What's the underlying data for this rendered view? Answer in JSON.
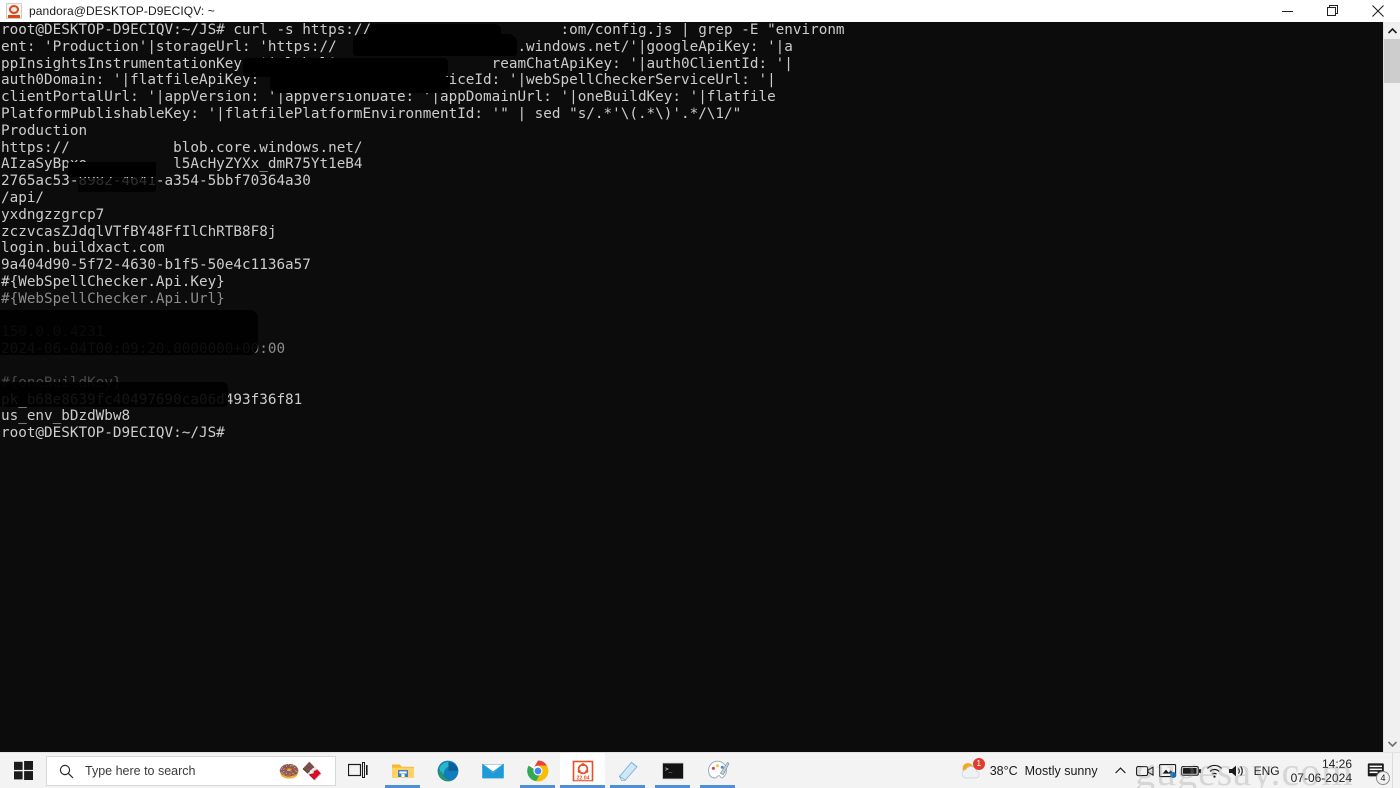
{
  "window": {
    "title": "pandora@DESKTOP-D9ECIQV: ~",
    "icon": "ubuntu-icon",
    "minimize_label": "Minimize",
    "maximize_label": "Restore",
    "close_label": "Close"
  },
  "terminal": {
    "lines": [
      {
        "text": "root@DESKTOP-D9ECIQV:~/JS# curl -s https://app.                  :om/config.js | grep -E \"environm",
        "tone": "normal"
      },
      {
        "text": "ent: 'Production'|storageUrl: 'https://                  ore.windows.net/'|googleApiKey: '|a",
        "tone": "normal"
      },
      {
        "text": "ppInsightsInstrumentationKey: '|globalA                  reamChatApiKey: '|auth0ClientId: '|",
        "tone": "normal"
      },
      {
        "text": "auth0Domain: '|flatfileApiKey: '|webSpellCheckerServiceId: '|webSpellCheckerServiceUrl: '|",
        "tone": "normal"
      },
      {
        "text": "clientPortalUrl: '|appVersion: '|appVersionDate: '|appDomainUrl: '|oneBuildKey: '|flatfile",
        "tone": "normal"
      },
      {
        "text": "PlatformPublishableKey: '|flatfilePlatformEnvironmentId: '\" | sed \"s/.*'\\(.*\\)'.*/\\1/\"",
        "tone": "normal"
      },
      {
        "text": "Production",
        "tone": "normal"
      },
      {
        "text": "https://            blob.core.windows.net/",
        "tone": "normal"
      },
      {
        "text": "AIzaSyBpxo          l5AcHyZYXx_dmR75Yt1eB4",
        "tone": "normal"
      },
      {
        "text": "2765ac53-8982-4641-a354-5bbf70364a30",
        "tone": "normal"
      },
      {
        "text": "/api/",
        "tone": "normal"
      },
      {
        "text": "yxdngzzgrcp7",
        "tone": "normal"
      },
      {
        "text": "zczvcasZJdqlVTfBY48FfIlChRTB8F8j",
        "tone": "normal"
      },
      {
        "text": "login.buildxact.com",
        "tone": "normal"
      },
      {
        "text": "9a404d90-5f72-4630-b1f5-50e4c1136a57",
        "tone": "normal"
      },
      {
        "text": "#{WebSpellChecker.Api.Key}",
        "tone": "normal"
      },
      {
        "text": "#{WebSpellChecker.Api.Url}",
        "tone": "dim"
      },
      {
        "text": "",
        "tone": "normal"
      },
      {
        "text": "150.0.0.4231",
        "tone": "dimmer"
      },
      {
        "text": "2024-06-04T00:09:20.0000000+00:00",
        "tone": "dim"
      },
      {
        "text": "",
        "tone": "normal"
      },
      {
        "text": "#{oneBuildKey}",
        "tone": "faint"
      },
      {
        "text": "pk_b68e8639fc40497690ca06d493f36f81",
        "tone": "normal"
      },
      {
        "text": "us_env_bDzdWbw8",
        "tone": "normal"
      },
      {
        "text": "root@DESKTOP-D9ECIQV:~/JS#",
        "tone": "normal"
      }
    ],
    "scrollbar": {
      "up_arrow": "chevron-up-icon",
      "down_arrow": "chevron-down-icon"
    }
  },
  "taskbar": {
    "start_label": "Start",
    "search": {
      "placeholder": "Type here to search",
      "icon": "search-icon",
      "doodle_donut": "🍩",
      "doodle_eclair": "🍫"
    },
    "task_view_label": "Task View",
    "apps": [
      {
        "name": "file-explorer",
        "label": "File Explorer",
        "active": false,
        "running": true
      },
      {
        "name": "microsoft-edge",
        "label": "Microsoft Edge",
        "active": false,
        "running": false
      },
      {
        "name": "mail",
        "label": "Mail",
        "active": false,
        "running": false
      },
      {
        "name": "google-chrome",
        "label": "Google Chrome",
        "active": false,
        "running": true
      },
      {
        "name": "ubuntu-2204",
        "label": "Ubuntu 22.04",
        "active": true,
        "running": true,
        "badge": "22.04"
      },
      {
        "name": "sticky-notes",
        "label": "Sticky Notes",
        "active": false,
        "running": true
      },
      {
        "name": "command-prompt",
        "label": "Command Prompt",
        "active": false,
        "running": true
      },
      {
        "name": "paint",
        "label": "Paint",
        "active": false,
        "running": true
      }
    ],
    "tray": {
      "weather": {
        "temperature": "38°C",
        "condition": "Mostly sunny",
        "badge": "1"
      },
      "chevron_label": "Show hidden icons",
      "icons": [
        {
          "name": "meet-now-icon",
          "label": "Meet Now"
        },
        {
          "name": "onedrive-icon",
          "label": "OneDrive"
        },
        {
          "name": "battery-icon",
          "label": "Battery"
        },
        {
          "name": "network-icon",
          "label": "Network"
        },
        {
          "name": "volume-icon",
          "label": "Volume"
        }
      ],
      "language": "ENG",
      "clock": {
        "time": "14:26",
        "date": "07-06-2024"
      },
      "notifications_badge": "4"
    }
  },
  "watermark": "gugesay.com",
  "colors": {
    "terminal_bg": "#0c0c0c",
    "terminal_fg": "#cccccc",
    "taskbar_bg": "#f3f3f3",
    "accent": "#4f8fd8",
    "ubuntu_orange": "#dd4814",
    "badge_red": "#e03b2f"
  }
}
